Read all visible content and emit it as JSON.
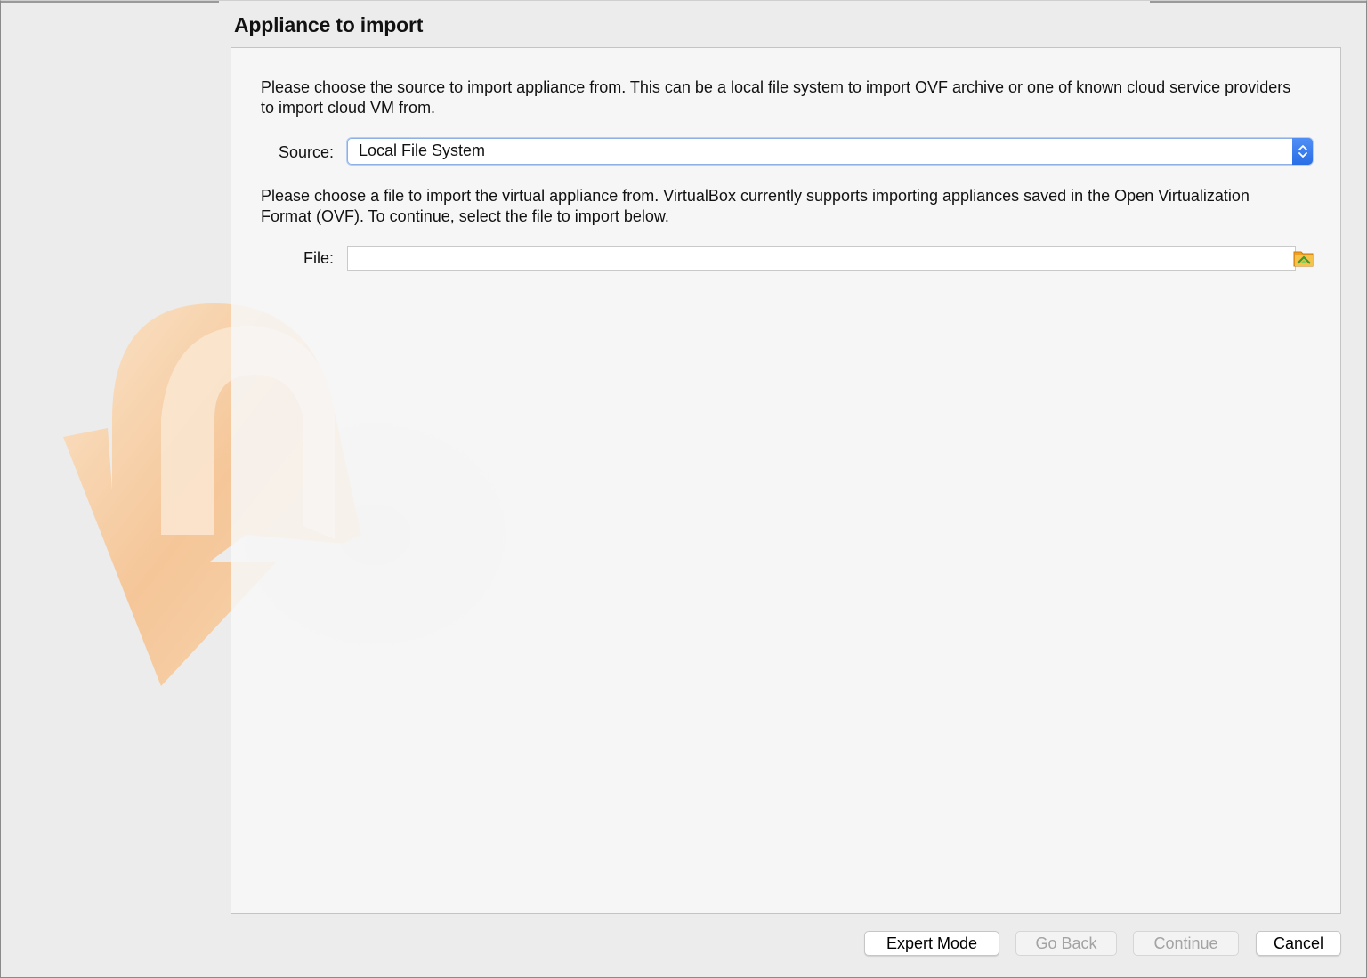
{
  "wizard": {
    "title": "Appliance to import",
    "source_description": "Please choose the source to import appliance from. This can be a local file system to import OVF archive or one of known cloud service providers to import cloud VM from.",
    "source_label": "Source:",
    "source_value": "Local File System",
    "file_description": "Please choose a file to import the virtual appliance from. VirtualBox currently supports importing appliances saved in the Open Virtualization Format (OVF). To continue, select the file to import below.",
    "file_label": "File:",
    "file_value": "",
    "file_chooser_icon": "folder-open-icon"
  },
  "buttons": {
    "expert_mode": "Expert Mode",
    "go_back": "Go Back",
    "continue": "Continue",
    "cancel": "Cancel"
  },
  "colors": {
    "accent": "#2a6ee6",
    "watermark": "#f5c08a"
  }
}
